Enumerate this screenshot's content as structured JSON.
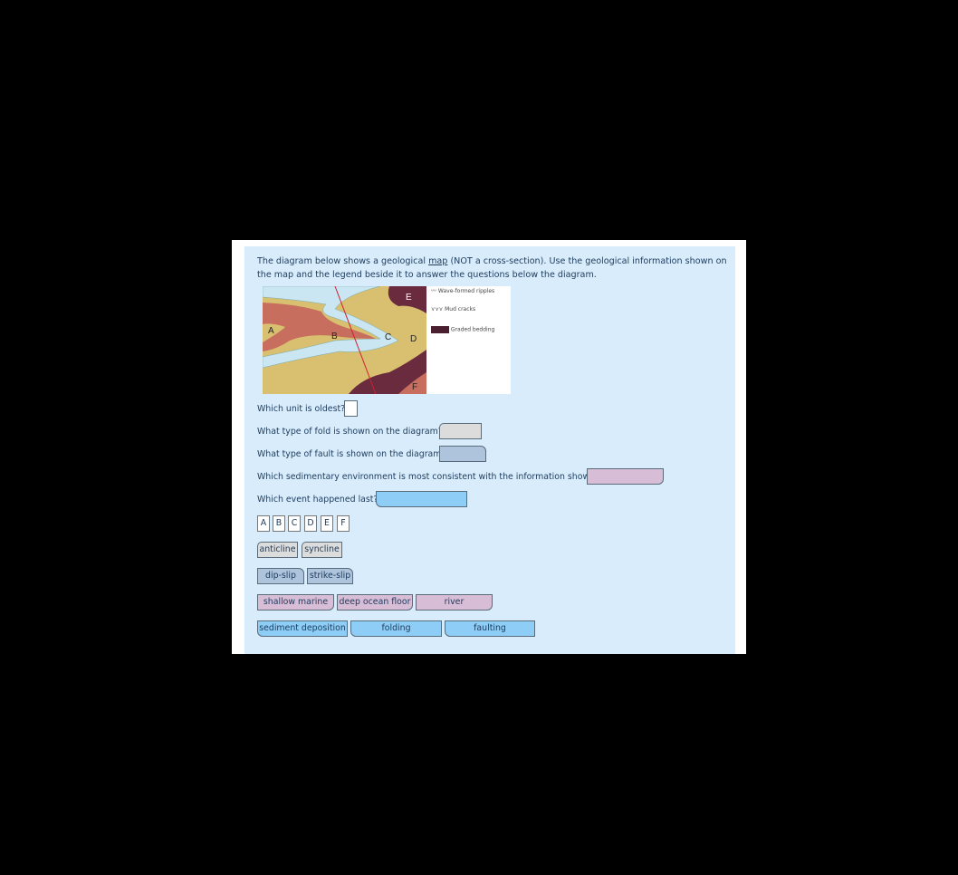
{
  "intro": {
    "before": "The diagram below shows a geological ",
    "link": "map",
    "after": " (NOT a cross-section).  Use the geological information shown on the map and the legend beside it to answer the questions below the diagram."
  },
  "map": {
    "unit_labels": [
      "A",
      "B",
      "C",
      "D",
      "E",
      "F"
    ]
  },
  "legend": {
    "ripples": "Wave-formed ripples",
    "mudcracks": "Mud cracks",
    "graded": "Graded bedding"
  },
  "questions": [
    {
      "text": "Which unit is oldest?"
    },
    {
      "text": "What type of fold is shown on the diagram?"
    },
    {
      "text": "What type of fault is shown on the diagram?"
    },
    {
      "text": "Which sedimentary environment is most consistent with the information shown?"
    },
    {
      "text": "Which event happened last?"
    }
  ],
  "options": {
    "units": [
      "A",
      "B",
      "C",
      "D",
      "E",
      "F"
    ],
    "folds": [
      "anticline",
      "syncline"
    ],
    "faults": [
      "dip-slip",
      "strike-slip"
    ],
    "environments": [
      "shallow marine",
      "deep ocean floor",
      "river"
    ],
    "events": [
      "sediment deposition",
      "folding",
      "faulting"
    ]
  },
  "colors": {
    "fold": "#dcdcdc",
    "fault": "#aec3dc",
    "environment": "#d8bdd6",
    "event": "#8ecdf5",
    "background": "#d8ecfb"
  }
}
